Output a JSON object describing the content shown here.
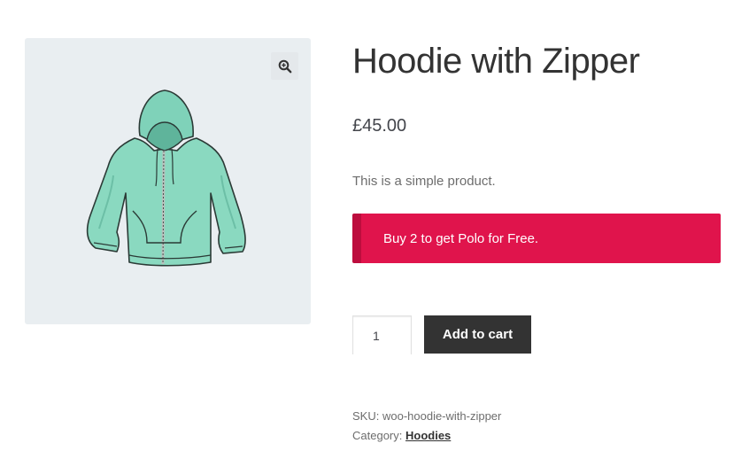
{
  "gallery": {
    "zoom_icon": "zoom-in-icon",
    "image_alt": "Hoodie with Zipper"
  },
  "product": {
    "title": "Hoodie with Zipper",
    "price": "£45.00",
    "short_description": "This is a simple product."
  },
  "promo": {
    "text": "Buy 2 to get Polo for Free.",
    "background_color": "#e0144c",
    "border_color": "#bd0d3e"
  },
  "cart": {
    "quantity": "1",
    "add_to_cart_label": "Add to cart",
    "button_color": "#333333"
  },
  "meta": {
    "sku_label": "SKU:",
    "sku_value": "woo-hoodie-with-zipper",
    "category_label": "Category:",
    "category_value": "Hoodies"
  }
}
